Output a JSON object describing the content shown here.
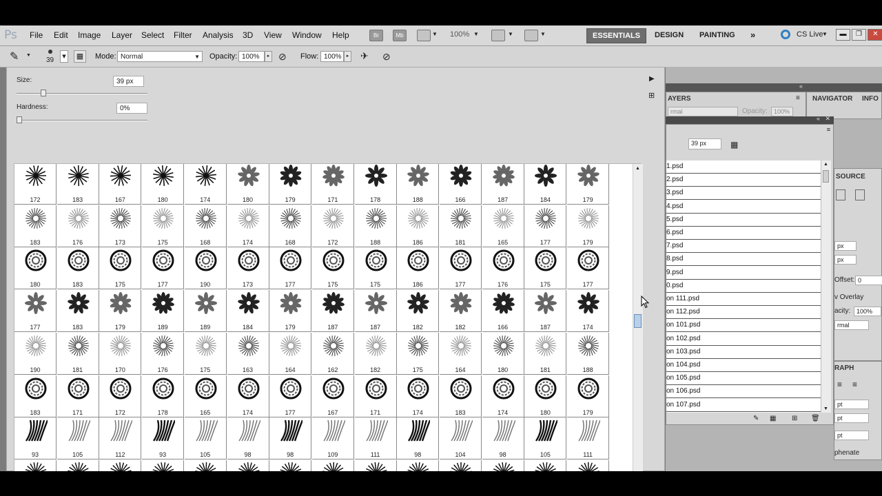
{
  "app": {
    "logo": "Ps",
    "zoom": "100%"
  },
  "menu": [
    "File",
    "Edit",
    "Image",
    "Layer",
    "Select",
    "Filter",
    "Analysis",
    "3D",
    "View",
    "Window",
    "Help"
  ],
  "menubar_icons": [
    "Br",
    "Mb"
  ],
  "workspaces": {
    "active": "ESSENTIALS",
    "items": [
      "DESIGN",
      "PAINTING"
    ],
    "more": "»",
    "cslive": "CS Live"
  },
  "options": {
    "brush_size": "39",
    "mode_label": "Mode:",
    "mode_value": "Normal",
    "opacity_label": "Opacity:",
    "opacity_value": "100%",
    "flow_label": "Flow:",
    "flow_value": "100%"
  },
  "picker": {
    "size_label": "Size:",
    "size_value": "39 px",
    "size_fraction": 0.19,
    "hardness_label": "Hardness:",
    "hardness_value": "0%",
    "hardness_fraction": 0.0
  },
  "brush_rows": [
    [
      "172",
      "183",
      "167",
      "180",
      "174",
      "180",
      "179",
      "171",
      "178",
      "188",
      "166",
      "187",
      "184",
      "179"
    ],
    [
      "183",
      "176",
      "173",
      "175",
      "168",
      "174",
      "168",
      "172",
      "188",
      "186",
      "181",
      "165",
      "177",
      "179"
    ],
    [
      "180",
      "183",
      "175",
      "177",
      "190",
      "173",
      "177",
      "175",
      "175",
      "186",
      "177",
      "176",
      "175",
      "177"
    ],
    [
      "177",
      "183",
      "179",
      "189",
      "189",
      "184",
      "179",
      "187",
      "187",
      "182",
      "182",
      "166",
      "187",
      "174"
    ],
    [
      "190",
      "181",
      "170",
      "176",
      "175",
      "163",
      "164",
      "162",
      "182",
      "175",
      "164",
      "180",
      "181",
      "188"
    ],
    [
      "183",
      "171",
      "172",
      "178",
      "165",
      "174",
      "177",
      "167",
      "171",
      "174",
      "183",
      "174",
      "180",
      "179"
    ],
    [
      "93",
      "105",
      "112",
      "93",
      "105",
      "98",
      "98",
      "109",
      "111",
      "98",
      "104",
      "98",
      "105",
      "111"
    ],
    [
      "",
      "",
      "",
      "",
      "",
      "",
      "",
      "",
      "",
      "",
      "",
      "",
      "",
      ""
    ]
  ],
  "panels": {
    "layers_tab": "AYERS",
    "layers_mode": "rmal",
    "layers_opacity_label": "Opacity:",
    "layers_opacity_value": "100%",
    "navigator_tab": "NAVIGATOR",
    "info_tab": "INFO",
    "preset_size": "39 px",
    "source_tab": "SOURCE",
    "paragraph_tab": "RAPH",
    "brush_files": [
      "1.psd",
      "2.psd",
      "3.psd",
      "4.psd",
      "5.psd",
      "6.psd",
      "7.psd",
      "8.psd",
      "9.psd",
      "0.psd",
      "on 111.psd",
      "on 112.psd",
      "on 101.psd",
      "on 102.psd",
      "on 103.psd",
      "on 104.psd",
      "on 105.psd",
      "on 106.psd",
      "on 107.psd"
    ],
    "clone_fields": [
      "px",
      "px"
    ],
    "offset_label": "Offset:",
    "offset_value": "0",
    "overlay_label": "v Overlay",
    "opacity_label": "acity:",
    "opacity_value": "100%",
    "blend_value": "rmal",
    "pt_fields": [
      "pt",
      "pt",
      "pt"
    ],
    "hyphenate_label": "phenate"
  }
}
